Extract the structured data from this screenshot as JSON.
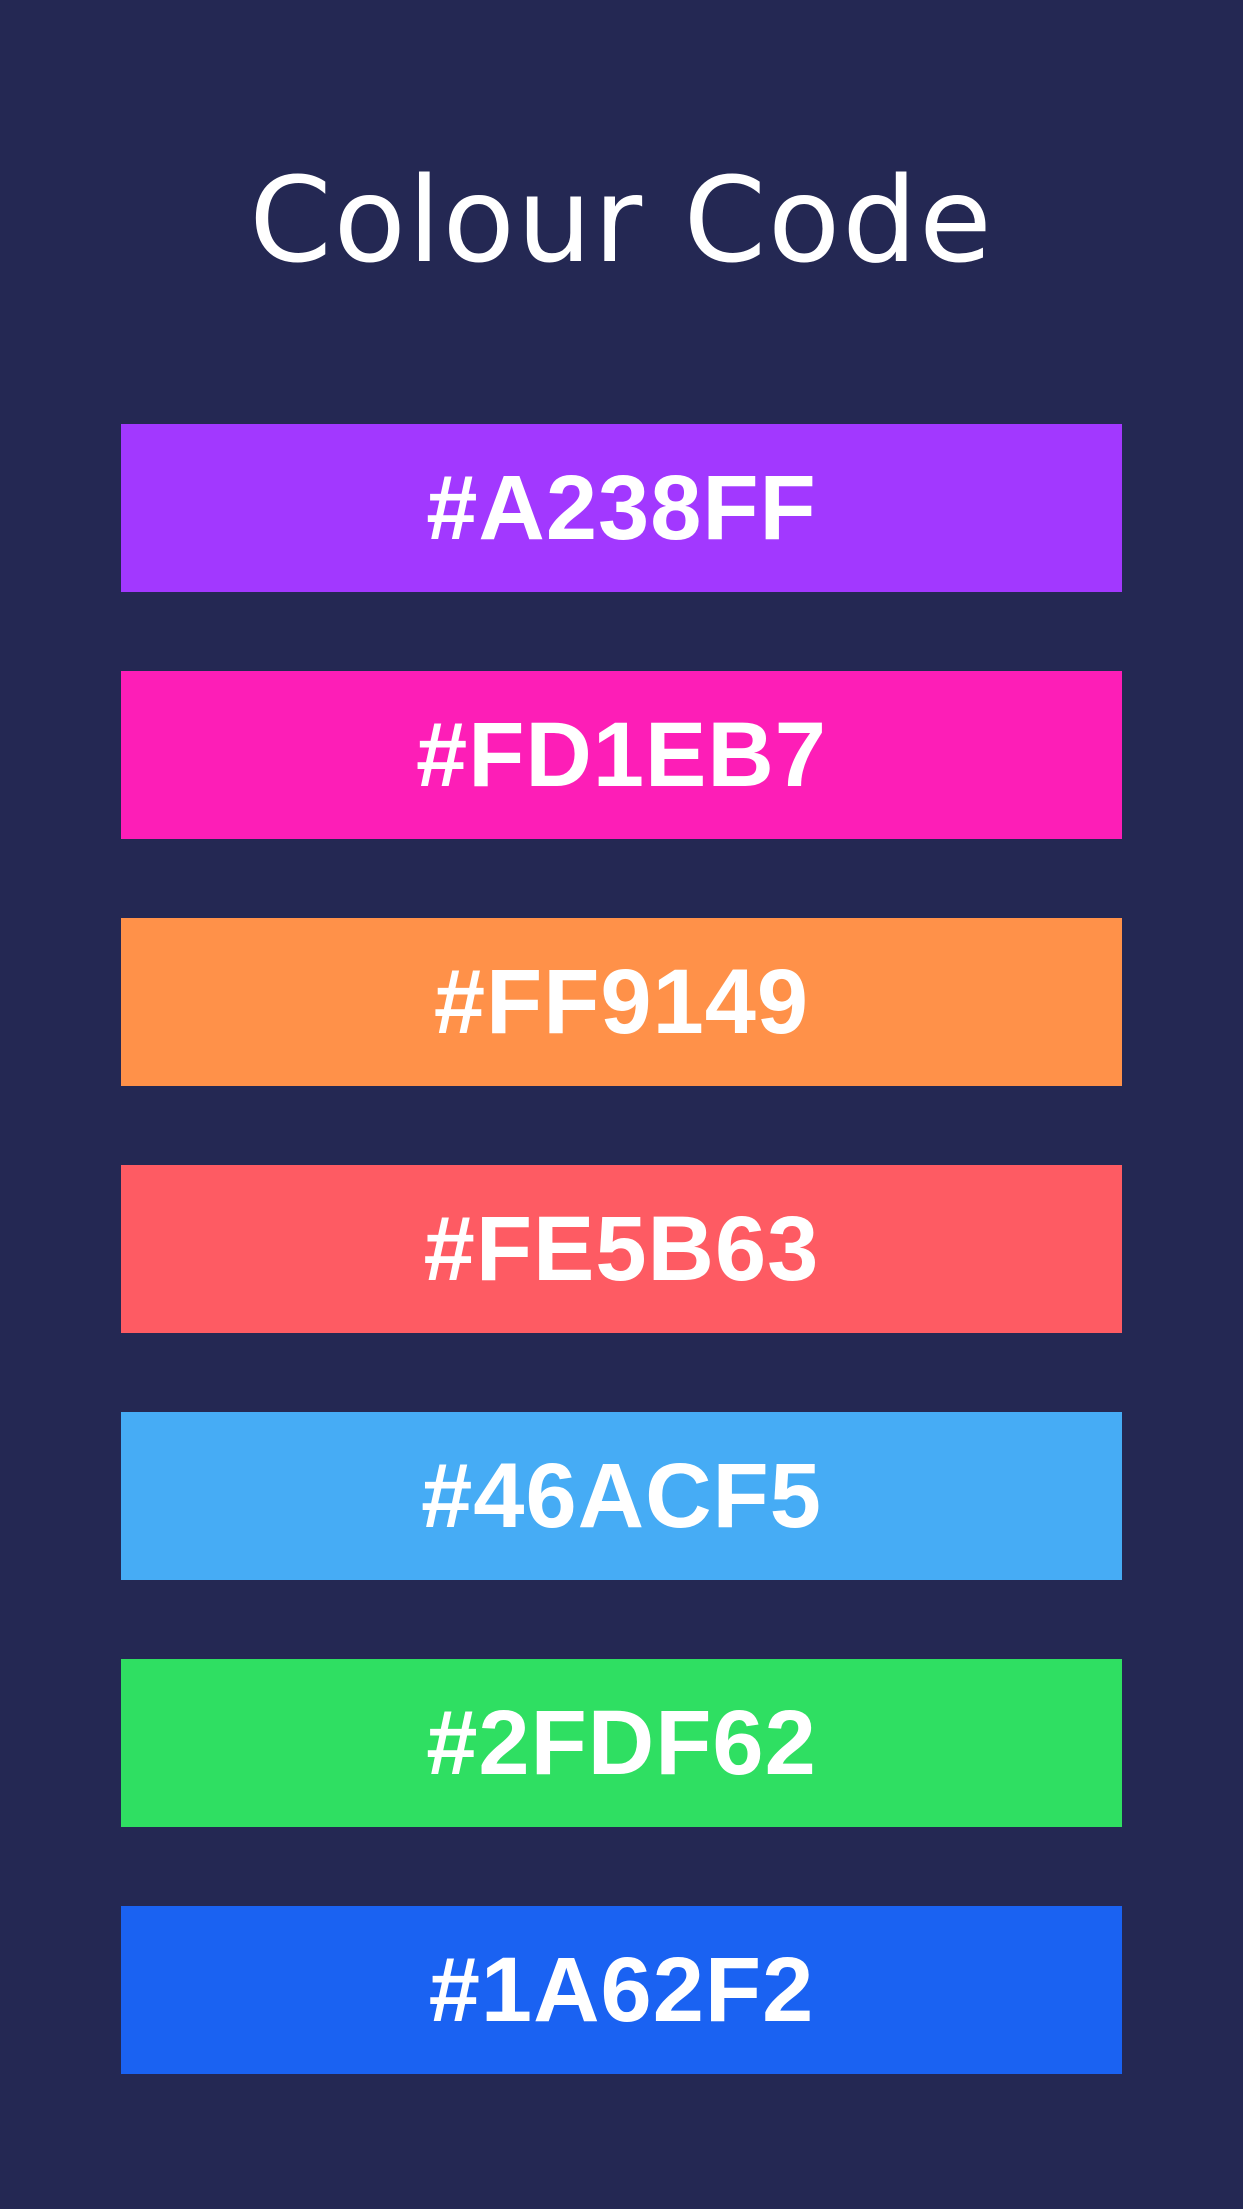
{
  "title": "Colour Code",
  "background_color": "#242853",
  "swatches": [
    {
      "label": "#A238FF",
      "color": "#A238FF"
    },
    {
      "label": "#FD1EB7",
      "color": "#FD1EB7"
    },
    {
      "label": "#FF9149",
      "color": "#FF9149"
    },
    {
      "label": "#FE5B63",
      "color": "#FE5B63"
    },
    {
      "label": "#46ACF5",
      "color": "#46ACF5"
    },
    {
      "label": "#2FDF62",
      "color": "#2FDF62"
    },
    {
      "label": "#1A62F2",
      "color": "#1A62F2"
    }
  ]
}
